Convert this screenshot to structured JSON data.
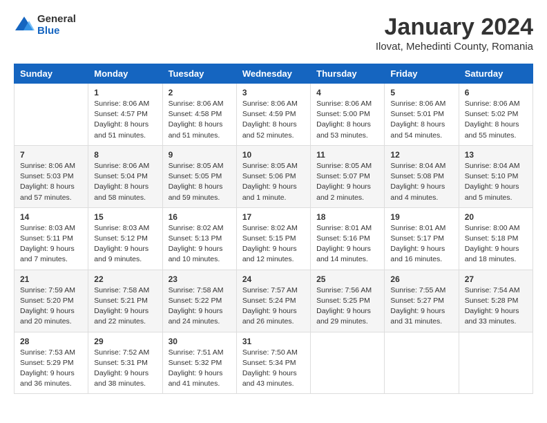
{
  "logo": {
    "general": "General",
    "blue": "Blue"
  },
  "title": "January 2024",
  "location": "Ilovat, Mehedinti County, Romania",
  "days_header": [
    "Sunday",
    "Monday",
    "Tuesday",
    "Wednesday",
    "Thursday",
    "Friday",
    "Saturday"
  ],
  "weeks": [
    [
      {
        "day": "",
        "sunrise": "",
        "sunset": "",
        "daylight": ""
      },
      {
        "day": "1",
        "sunrise": "Sunrise: 8:06 AM",
        "sunset": "Sunset: 4:57 PM",
        "daylight": "Daylight: 8 hours and 51 minutes."
      },
      {
        "day": "2",
        "sunrise": "Sunrise: 8:06 AM",
        "sunset": "Sunset: 4:58 PM",
        "daylight": "Daylight: 8 hours and 51 minutes."
      },
      {
        "day": "3",
        "sunrise": "Sunrise: 8:06 AM",
        "sunset": "Sunset: 4:59 PM",
        "daylight": "Daylight: 8 hours and 52 minutes."
      },
      {
        "day": "4",
        "sunrise": "Sunrise: 8:06 AM",
        "sunset": "Sunset: 5:00 PM",
        "daylight": "Daylight: 8 hours and 53 minutes."
      },
      {
        "day": "5",
        "sunrise": "Sunrise: 8:06 AM",
        "sunset": "Sunset: 5:01 PM",
        "daylight": "Daylight: 8 hours and 54 minutes."
      },
      {
        "day": "6",
        "sunrise": "Sunrise: 8:06 AM",
        "sunset": "Sunset: 5:02 PM",
        "daylight": "Daylight: 8 hours and 55 minutes."
      }
    ],
    [
      {
        "day": "7",
        "sunrise": "Sunrise: 8:06 AM",
        "sunset": "Sunset: 5:03 PM",
        "daylight": "Daylight: 8 hours and 57 minutes."
      },
      {
        "day": "8",
        "sunrise": "Sunrise: 8:06 AM",
        "sunset": "Sunset: 5:04 PM",
        "daylight": "Daylight: 8 hours and 58 minutes."
      },
      {
        "day": "9",
        "sunrise": "Sunrise: 8:05 AM",
        "sunset": "Sunset: 5:05 PM",
        "daylight": "Daylight: 8 hours and 59 minutes."
      },
      {
        "day": "10",
        "sunrise": "Sunrise: 8:05 AM",
        "sunset": "Sunset: 5:06 PM",
        "daylight": "Daylight: 9 hours and 1 minute."
      },
      {
        "day": "11",
        "sunrise": "Sunrise: 8:05 AM",
        "sunset": "Sunset: 5:07 PM",
        "daylight": "Daylight: 9 hours and 2 minutes."
      },
      {
        "day": "12",
        "sunrise": "Sunrise: 8:04 AM",
        "sunset": "Sunset: 5:08 PM",
        "daylight": "Daylight: 9 hours and 4 minutes."
      },
      {
        "day": "13",
        "sunrise": "Sunrise: 8:04 AM",
        "sunset": "Sunset: 5:10 PM",
        "daylight": "Daylight: 9 hours and 5 minutes."
      }
    ],
    [
      {
        "day": "14",
        "sunrise": "Sunrise: 8:03 AM",
        "sunset": "Sunset: 5:11 PM",
        "daylight": "Daylight: 9 hours and 7 minutes."
      },
      {
        "day": "15",
        "sunrise": "Sunrise: 8:03 AM",
        "sunset": "Sunset: 5:12 PM",
        "daylight": "Daylight: 9 hours and 9 minutes."
      },
      {
        "day": "16",
        "sunrise": "Sunrise: 8:02 AM",
        "sunset": "Sunset: 5:13 PM",
        "daylight": "Daylight: 9 hours and 10 minutes."
      },
      {
        "day": "17",
        "sunrise": "Sunrise: 8:02 AM",
        "sunset": "Sunset: 5:15 PM",
        "daylight": "Daylight: 9 hours and 12 minutes."
      },
      {
        "day": "18",
        "sunrise": "Sunrise: 8:01 AM",
        "sunset": "Sunset: 5:16 PM",
        "daylight": "Daylight: 9 hours and 14 minutes."
      },
      {
        "day": "19",
        "sunrise": "Sunrise: 8:01 AM",
        "sunset": "Sunset: 5:17 PM",
        "daylight": "Daylight: 9 hours and 16 minutes."
      },
      {
        "day": "20",
        "sunrise": "Sunrise: 8:00 AM",
        "sunset": "Sunset: 5:18 PM",
        "daylight": "Daylight: 9 hours and 18 minutes."
      }
    ],
    [
      {
        "day": "21",
        "sunrise": "Sunrise: 7:59 AM",
        "sunset": "Sunset: 5:20 PM",
        "daylight": "Daylight: 9 hours and 20 minutes."
      },
      {
        "day": "22",
        "sunrise": "Sunrise: 7:58 AM",
        "sunset": "Sunset: 5:21 PM",
        "daylight": "Daylight: 9 hours and 22 minutes."
      },
      {
        "day": "23",
        "sunrise": "Sunrise: 7:58 AM",
        "sunset": "Sunset: 5:22 PM",
        "daylight": "Daylight: 9 hours and 24 minutes."
      },
      {
        "day": "24",
        "sunrise": "Sunrise: 7:57 AM",
        "sunset": "Sunset: 5:24 PM",
        "daylight": "Daylight: 9 hours and 26 minutes."
      },
      {
        "day": "25",
        "sunrise": "Sunrise: 7:56 AM",
        "sunset": "Sunset: 5:25 PM",
        "daylight": "Daylight: 9 hours and 29 minutes."
      },
      {
        "day": "26",
        "sunrise": "Sunrise: 7:55 AM",
        "sunset": "Sunset: 5:27 PM",
        "daylight": "Daylight: 9 hours and 31 minutes."
      },
      {
        "day": "27",
        "sunrise": "Sunrise: 7:54 AM",
        "sunset": "Sunset: 5:28 PM",
        "daylight": "Daylight: 9 hours and 33 minutes."
      }
    ],
    [
      {
        "day": "28",
        "sunrise": "Sunrise: 7:53 AM",
        "sunset": "Sunset: 5:29 PM",
        "daylight": "Daylight: 9 hours and 36 minutes."
      },
      {
        "day": "29",
        "sunrise": "Sunrise: 7:52 AM",
        "sunset": "Sunset: 5:31 PM",
        "daylight": "Daylight: 9 hours and 38 minutes."
      },
      {
        "day": "30",
        "sunrise": "Sunrise: 7:51 AM",
        "sunset": "Sunset: 5:32 PM",
        "daylight": "Daylight: 9 hours and 41 minutes."
      },
      {
        "day": "31",
        "sunrise": "Sunrise: 7:50 AM",
        "sunset": "Sunset: 5:34 PM",
        "daylight": "Daylight: 9 hours and 43 minutes."
      },
      {
        "day": "",
        "sunrise": "",
        "sunset": "",
        "daylight": ""
      },
      {
        "day": "",
        "sunrise": "",
        "sunset": "",
        "daylight": ""
      },
      {
        "day": "",
        "sunrise": "",
        "sunset": "",
        "daylight": ""
      }
    ]
  ]
}
